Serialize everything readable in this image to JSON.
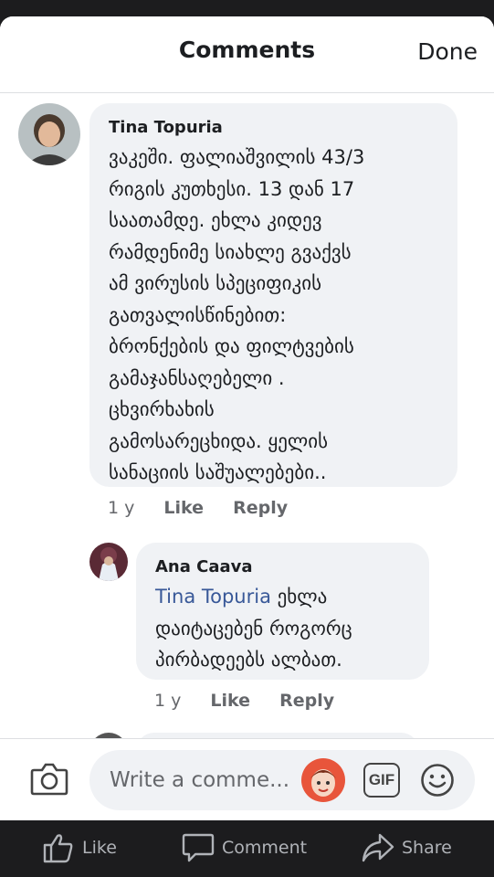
{
  "header": {
    "title": "Comments",
    "done_label": "Done"
  },
  "comments": [
    {
      "author": "Tina Topuria",
      "text": "ვაკეში. ფალიაშვილის 43/3\nრიგის კუთხესი. 13 დან 17\nსაათამდე. ეხლა კიდევ\nრამდენიმე სიახლე გვაქვს\nამ ვირუსის სპეციფიკის\nგათვალისწინებით:\nბრონქების და ფილტვების\nგამაჯანსაღებელი .\nცხვირხახის\nგამოსარეცხიდა. ყელის\nსანაციის საშუალებები..",
      "time": "1 y",
      "like_label": "Like",
      "reply_label": "Reply"
    },
    {
      "author": "Ana Caava",
      "mention": "Tina Topuria",
      "text_after_mention": " ეხლა\nდაიტაცებენ როგორც\nპირბადეებს ალბათ.",
      "time": "1 y",
      "like_label": "Like",
      "reply_label": "Reply"
    }
  ],
  "composer": {
    "placeholder": "Write a comme...",
    "gif_label": "GIF"
  },
  "tabbar": {
    "like_label": "Like",
    "comment_label": "Comment",
    "share_label": "Share"
  },
  "colors": {
    "bubble": "#f0f2f5",
    "mention": "#385898",
    "meta": "#65676b",
    "tabbar_bg": "#1c1c1e"
  }
}
